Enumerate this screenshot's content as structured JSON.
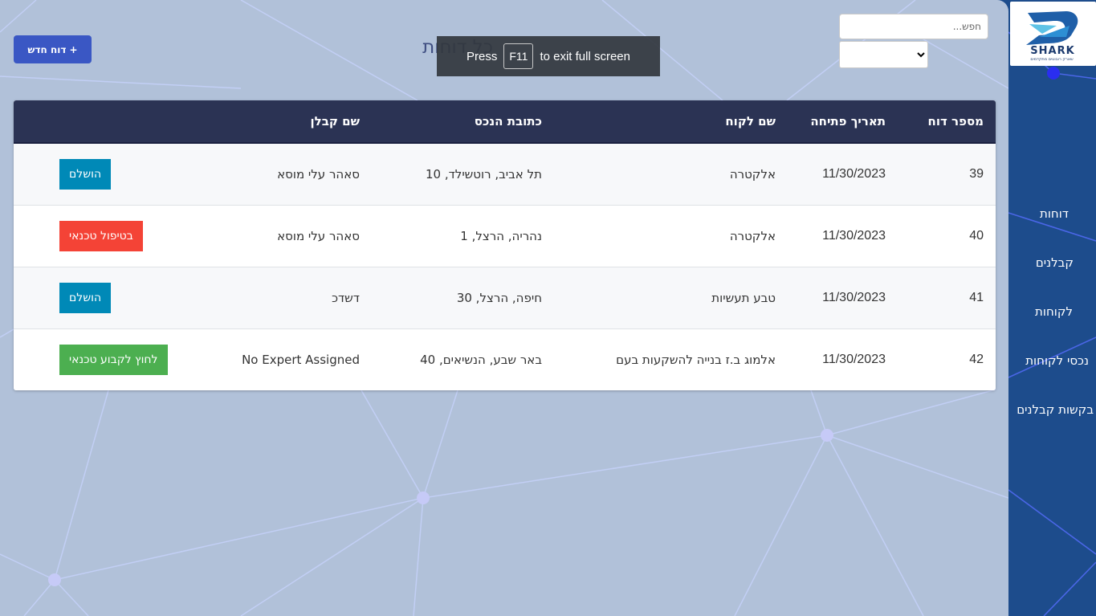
{
  "brand": {
    "logo_text": "SHARK",
    "logo_subtitle": "שארק רובוטים מתקדמים"
  },
  "sidebar": {
    "items": [
      {
        "label": "דוחות"
      },
      {
        "label": "קבלנים"
      },
      {
        "label": "לקוחות"
      },
      {
        "label": "נכסי לקוחות"
      },
      {
        "label": "בקשות קבלנים"
      }
    ]
  },
  "toolbar": {
    "search_placeholder": "חפש...",
    "filter_selected": "",
    "new_report_label": "דוח חדש +"
  },
  "page": {
    "title": "כל דוחות"
  },
  "fullscreen_notice": {
    "press": "Press",
    "key": "F11",
    "message": "to exit full screen"
  },
  "table": {
    "headers": [
      "מספר דוח",
      "תאריך פתיחה",
      "שם לקוח",
      "כתובת הנכס",
      "שם קבלן",
      ""
    ],
    "rows": [
      {
        "id": "39",
        "date": "11/30/2023",
        "client": "אלקטרה",
        "address": "תל אביב, רוטשילד, 10",
        "contractor": "סאהר עלי מוסא",
        "status": "הושלם",
        "status_color": "#0089b7"
      },
      {
        "id": "40",
        "date": "11/30/2023",
        "client": "אלקטרה",
        "address": "נהריה, הרצל, 1",
        "contractor": "סאהר עלי מוסא",
        "status": "בטיפול טכנאי",
        "status_color": "#f44336"
      },
      {
        "id": "41",
        "date": "11/30/2023",
        "client": "טבע תעשיות",
        "address": "חיפה, הרצל, 30",
        "contractor": "דשדכ",
        "status": "הושלם",
        "status_color": "#0089b7"
      },
      {
        "id": "42",
        "date": "11/30/2023",
        "client": "אלמוג ב.ז בנייה להשקעות בעם",
        "address": "באר שבע, הנשיאים, 40",
        "contractor": "No Expert Assigned",
        "status": "לחוץ לקבוע טכנאי",
        "status_color": "#4caf50"
      }
    ]
  },
  "colors": {
    "sidebar_bg": "#1d4c8c",
    "main_bg": "#b1c1d9",
    "table_header_bg": "#2b3354",
    "primary_button": "#3a57c4"
  }
}
